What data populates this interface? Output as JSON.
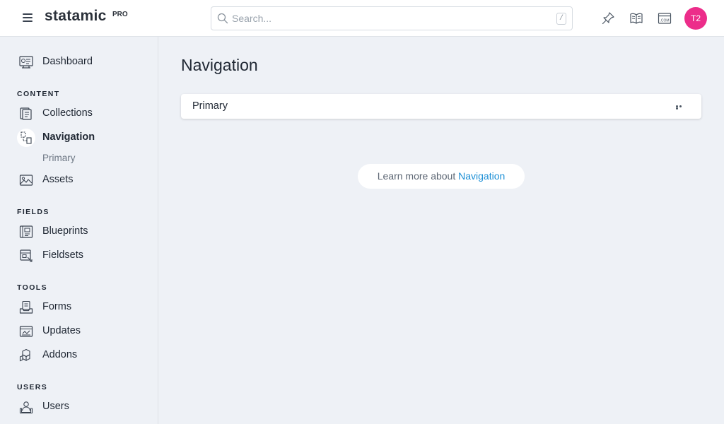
{
  "header": {
    "logo": "statamic",
    "logo_badge": "PRO",
    "search_placeholder": "Search...",
    "search_shortcut": "/",
    "avatar_initials": "T2",
    "avatar_color": "#ec2d8a",
    "icons": [
      "pin-icon",
      "docs-book-icon",
      "site-icon"
    ]
  },
  "sidebar": {
    "dashboard": "Dashboard",
    "sections": {
      "content": "CONTENT",
      "fields": "FIELDS",
      "tools": "TOOLS",
      "users": "USERS"
    },
    "items": {
      "collections": "Collections",
      "navigation": "Navigation",
      "navigation_sub": "Primary",
      "assets": "Assets",
      "blueprints": "Blueprints",
      "fieldsets": "Fieldsets",
      "forms": "Forms",
      "updates": "Updates",
      "addons": "Addons",
      "users": "Users"
    }
  },
  "main": {
    "title": "Navigation",
    "nav_list": [
      {
        "label": "Primary"
      }
    ],
    "learn_more_prefix": "Learn more about ",
    "learn_more_link": "Navigation",
    "link_color": "#1c8fd6"
  }
}
